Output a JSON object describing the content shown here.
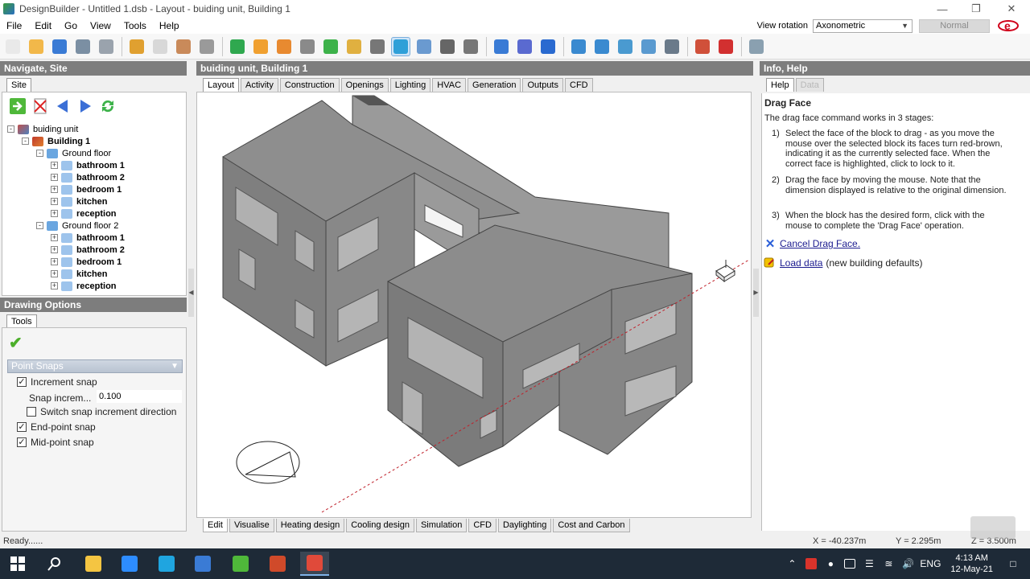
{
  "window": {
    "title": "DesignBuilder - Untitled 1.dsb - Layout - buiding unit, Building 1",
    "controls": [
      "minimize-icon",
      "restore-icon",
      "close-icon"
    ]
  },
  "menu": [
    "File",
    "Edit",
    "Go",
    "View",
    "Tools",
    "Help"
  ],
  "view_rotation": {
    "label": "View rotation",
    "value": "Axonometric",
    "mode": "Normal"
  },
  "toolbar_icons": [
    "new-file-icon",
    "open-folder-icon",
    "save-icon",
    "print-icon",
    "edit-note-icon",
    "wrench-icon",
    "eraser-icon",
    "import-icon",
    "block-icon",
    "select-arrow-icon",
    "add-block-icon",
    "add-partition-icon",
    "add-plane-icon",
    "add-cutting-plane-icon",
    "pen-icon",
    "measure-icon",
    "drag-face-icon",
    "stretch-icon",
    "rotate-icon",
    "hand-icon",
    "ruler-icon",
    "draw-icon",
    "undo-view-icon",
    "zoom-in-icon",
    "zoom-extents-icon",
    "zoom-window-icon",
    "zoom-out-icon",
    "toggle-icon",
    "table-icon",
    "target-icon",
    "layer-icon"
  ],
  "left_panel": {
    "header": "Navigate, Site",
    "tab": "Site",
    "tree": {
      "site": "buiding unit",
      "building": "Building 1",
      "floors": [
        {
          "name": "Ground floor",
          "zones": [
            "bathroom 1",
            "bathroom 2",
            "bedroom 1",
            "kitchen",
            "reception"
          ]
        },
        {
          "name": "Ground floor 2",
          "zones": [
            "bathroom 1",
            "bathroom 2",
            "bedroom 1",
            "kitchen",
            "reception"
          ]
        }
      ]
    }
  },
  "drawing_options": {
    "header": "Drawing Options",
    "tab": "Tools",
    "section": "Point Snaps",
    "increment_snap": {
      "label": "Increment snap",
      "checked": true
    },
    "snap_increment": {
      "label": "Snap increm...",
      "value": "0.100"
    },
    "switch_direction": {
      "label": "Switch snap increment direction",
      "checked": false
    },
    "endpoint_snap": {
      "label": "End-point snap",
      "checked": true
    },
    "midpoint_snap": {
      "label": "Mid-point snap",
      "checked": true
    }
  },
  "center": {
    "header": "buiding unit, Building 1",
    "tabs": [
      "Layout",
      "Activity",
      "Construction",
      "Openings",
      "Lighting",
      "HVAC",
      "Generation",
      "Outputs",
      "CFD"
    ],
    "active_tab": "Layout",
    "bottom_tabs": [
      "Edit",
      "Visualise",
      "Heating design",
      "Cooling design",
      "Simulation",
      "CFD",
      "Daylighting",
      "Cost and Carbon"
    ],
    "active_bottom_tab": "Edit",
    "model_color": "#8c8c8c"
  },
  "right_panel": {
    "header": "Info, Help",
    "tabs": [
      "Help",
      "Data"
    ],
    "title": "Drag Face",
    "intro": "The drag face command works in 3 stages:",
    "steps": [
      {
        "n": "1)",
        "text": "Select the face of the block to drag - as you move the mouse over the selected block its faces turn red-brown, indicating it as the currently selected face. When the correct face is highlighted, click to lock to it."
      },
      {
        "n": "2)",
        "text": "Drag the face by moving the mouse. Note that the dimension displayed is relative to the original dimension."
      },
      {
        "n": "3)",
        "text": "When the block has the desired form, click with the mouse to complete the 'Drag Face' operation."
      }
    ],
    "cancel_link": "Cancel Drag Face.",
    "load_link": "Load data",
    "load_suffix": "(new building defaults)"
  },
  "status": {
    "text": "Ready......",
    "x": "X = -40.237m",
    "y": "Y = 2.295m",
    "z": "Z = 3.500m"
  },
  "taskbar": {
    "apps": [
      "start-icon",
      "search-icon",
      "file-explorer-icon",
      "zoom-app-icon",
      "edge-icon",
      "notepad-icon",
      "designbuilder-icon",
      "powerpoint-icon",
      "screencast-icon"
    ],
    "lang": "ENG",
    "time": "4:13 AM",
    "date": "12-May-21"
  }
}
